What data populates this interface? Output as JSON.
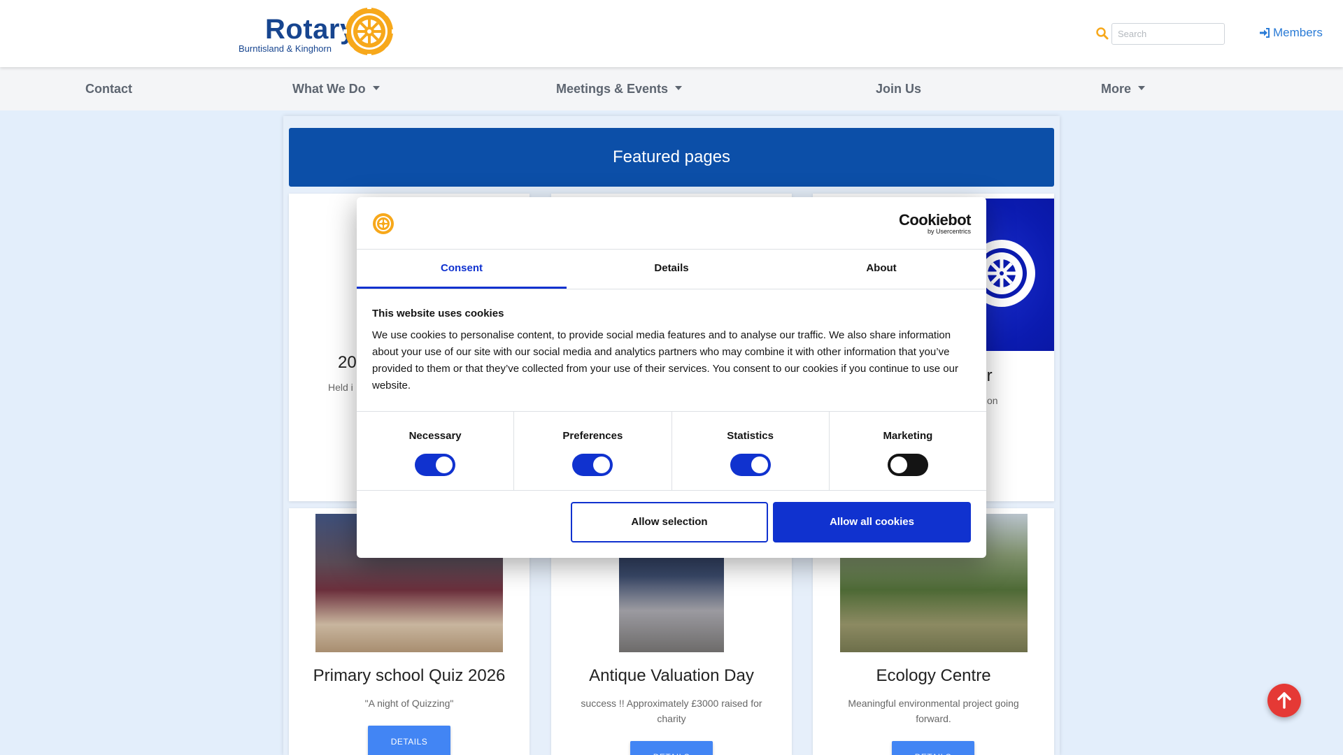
{
  "header": {
    "logo_word": "Rotary",
    "logo_sub": "Burntisland & Kinghorn",
    "search_placeholder": "Search",
    "members_label": "Members"
  },
  "nav": {
    "items": [
      {
        "label": "Contact",
        "dropdown": false
      },
      {
        "label": "What We Do",
        "dropdown": true
      },
      {
        "label": "Meetings & Events",
        "dropdown": true
      },
      {
        "label": "Join Us",
        "dropdown": false
      },
      {
        "label": "More",
        "dropdown": true
      }
    ]
  },
  "featured": {
    "title": "Featured pages",
    "top_cards": [
      {
        "title_fragment": "20",
        "desc_fragment": "Held i"
      },
      {
        "title_fragment": "tter",
        "desc_fragment": "tion"
      }
    ],
    "cards": [
      {
        "title": "Primary school Quiz 2026",
        "desc": "\"A night of Quizzing\"",
        "button": "DETAILS"
      },
      {
        "title": "Antique Valuation Day",
        "desc": "success !! Approximately £3000 raised for charity",
        "button": "DETAILS"
      },
      {
        "title": "Ecology Centre",
        "desc": "Meaningful environmental project going forward.",
        "button": "DETAILS"
      }
    ]
  },
  "cookie_dialog": {
    "brand_main": "Cookiebot",
    "brand_sub": "by Usercentrics",
    "tabs": [
      "Consent",
      "Details",
      "About"
    ],
    "active_tab": "Consent",
    "heading": "This website uses cookies",
    "body": "We use cookies to personalise content, to provide social media features and to analyse our traffic. We also share information about your use of our site with our social media and analytics partners who may combine it with other information that you’ve provided to them or that they’ve collected from your use of their services. You consent to our cookies if you continue to use our website.",
    "preferences": [
      {
        "label": "Necessary",
        "enabled": true
      },
      {
        "label": "Preferences",
        "enabled": true
      },
      {
        "label": "Statistics",
        "enabled": true
      },
      {
        "label": "Marketing",
        "enabled": false
      }
    ],
    "allow_selection_label": "Allow selection",
    "allow_all_label": "Allow all cookies"
  },
  "colors": {
    "rotary_blue": "#17458f",
    "rotary_gold": "#f7a81b",
    "banner_blue": "#0c4fa8",
    "cookiebot_blue": "#1032cf",
    "button_blue": "#4285f4",
    "back_to_top_red": "#e53935"
  },
  "icons": {
    "search": "search-icon",
    "members": "sign-in-icon",
    "back_to_top": "arrow-up-icon"
  }
}
